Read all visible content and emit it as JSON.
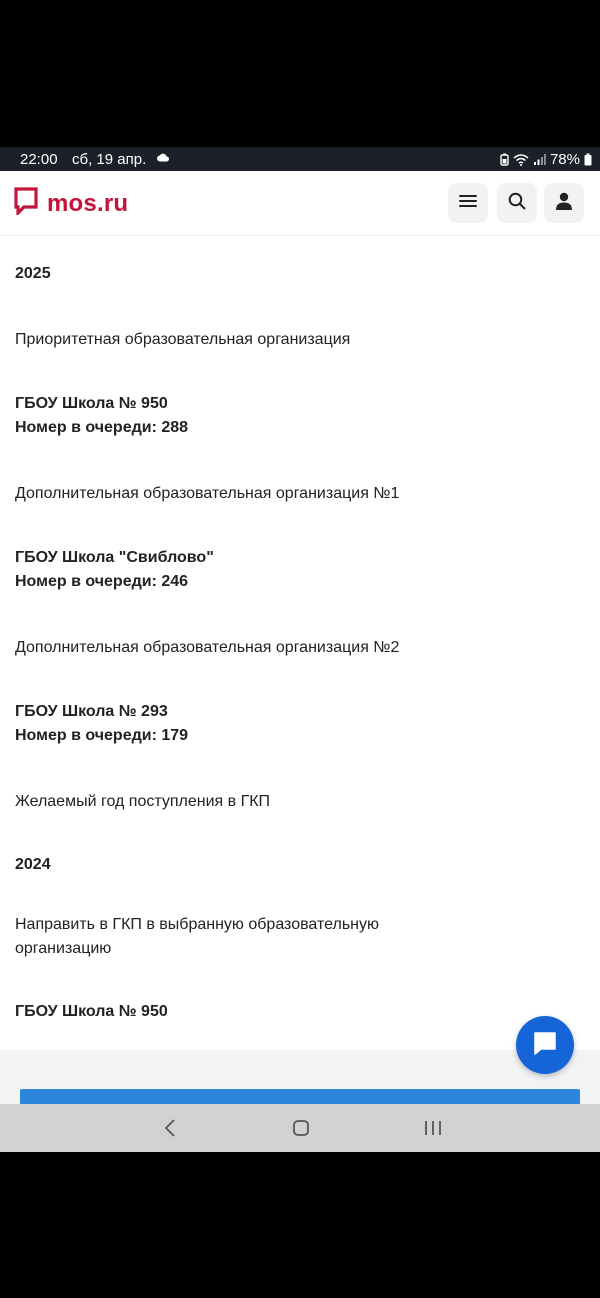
{
  "status_bar": {
    "time": "22:00",
    "date": "сб, 19 апр.",
    "battery": "78%"
  },
  "header": {
    "logo_text": "mos.ru",
    "brand_color": "#c3153c",
    "icons": [
      "menu-icon",
      "search-icon",
      "user-icon"
    ]
  },
  "content": {
    "year_2025": "2025",
    "priority_label": "Приоритетная образовательная организация",
    "school1_name": "ГБОУ Школа № 950",
    "school1_queue": "Номер в очереди: 288",
    "additional1_label": "Дополнительная образовательная организация №1",
    "school2_name": "ГБОУ Школа \"Свиблово\"",
    "school2_queue": "Номер в очереди: 246",
    "additional2_label": "Дополнительная образовательная организация №2",
    "school3_name": "ГБОУ Школа № 293",
    "school3_queue": "Номер в очереди: 179",
    "gkp_year_label": "Желаемый год поступления в ГКП",
    "year_2024": "2024",
    "direct_gkp_label": "Направить в ГКП в выбранную образовательную организацию",
    "school_final": "ГБОУ Школа № 950"
  },
  "chat": {
    "icon": "chat-icon",
    "color": "#1565d8"
  },
  "nav_bar": {
    "icons": [
      "back-icon",
      "home-icon",
      "recents-icon"
    ]
  }
}
